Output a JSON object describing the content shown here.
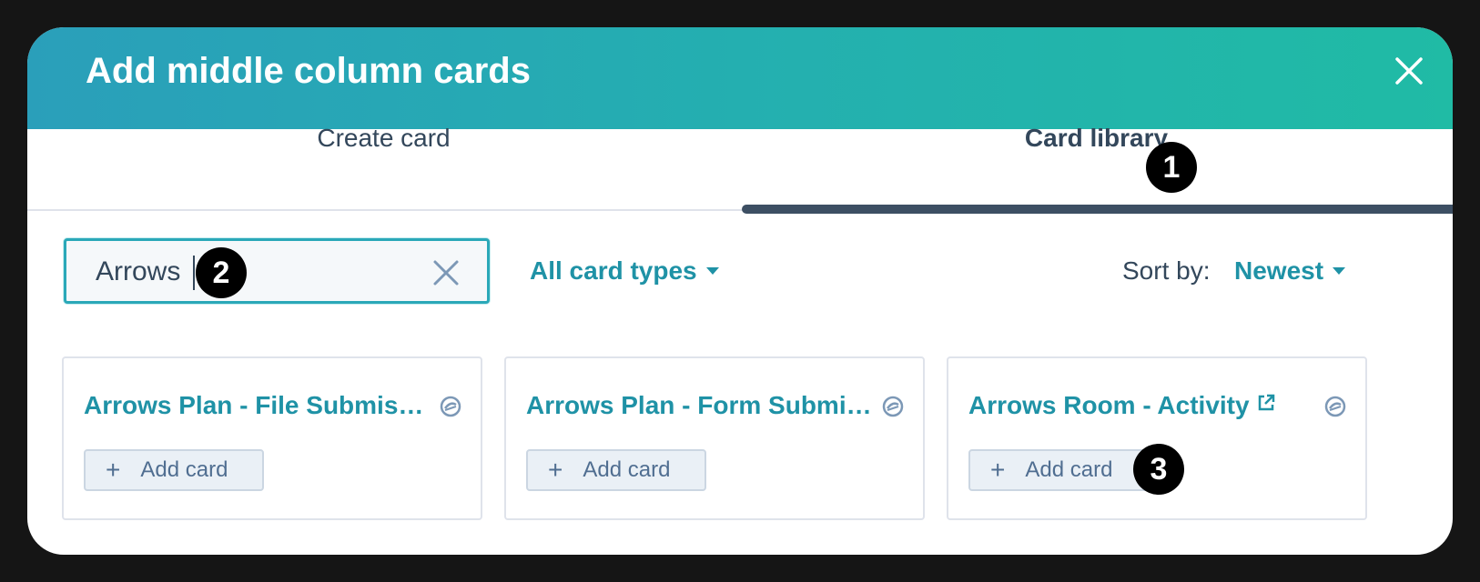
{
  "modal": {
    "title": "Add middle column cards",
    "close_icon": "close-icon"
  },
  "tabs": [
    {
      "label": "Create card",
      "active": false
    },
    {
      "label": "Card library",
      "active": true
    }
  ],
  "search": {
    "value": "Arrows",
    "clear_icon": "clear-x-icon"
  },
  "filter": {
    "label": "All card types",
    "icon": "caret-down-icon"
  },
  "sort": {
    "label": "Sort by:",
    "value": "Newest",
    "icon": "caret-down-icon"
  },
  "cards": [
    {
      "title": "Arrows Plan - File Submission",
      "badge_icon": "integration-badge-icon",
      "add_label": "Add card"
    },
    {
      "title": "Arrows Plan - Form Submission",
      "badge_icon": "integration-badge-icon",
      "add_label": "Add card"
    },
    {
      "title": "Arrows Room - Activity",
      "external_link_icon": "external-link-icon",
      "badge_icon": "integration-badge-icon",
      "add_label": "Add card"
    }
  ],
  "step_badges": [
    "1",
    "2",
    "3"
  ],
  "colors": {
    "accent": "#1f92a6",
    "header_gradient_start": "#2a9fba",
    "header_gradient_end": "#20bba5",
    "text_dark": "#33475b",
    "tab_indicator": "#3d4f63",
    "badge_bg": "#000000"
  }
}
